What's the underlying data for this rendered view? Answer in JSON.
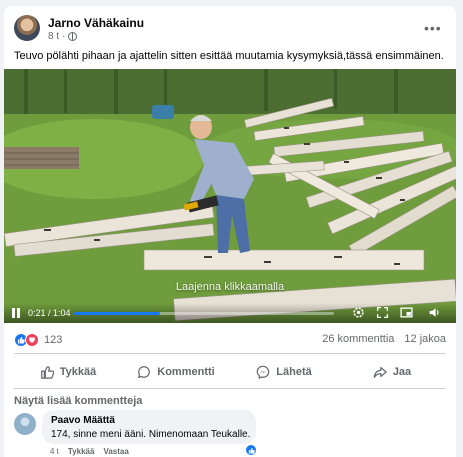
{
  "post": {
    "author": "Jarno Vähäkainu",
    "time": "8 t",
    "text": "Teuvo pölähti pihaan ja ajattelin sitten esittää muutamia kysymyksiä,tässä ensimmäinen."
  },
  "video": {
    "overlay_text": "Laajenna klikkaamalla",
    "time_display": "0:21 / 1:04",
    "progress": 0.33
  },
  "reactions": {
    "count": "123",
    "comments": "26 kommenttia",
    "shares": "12 jakoa"
  },
  "actions": {
    "like": "Tykkää",
    "comment": "Kommentti",
    "send": "Lähetä",
    "share": "Jaa"
  },
  "comments_section": {
    "more_label": "Näytä lisää kommentteja",
    "comment": {
      "author": "Paavo Määttä",
      "text": "174, sinne meni ääni. Nimenomaan Teukalle.",
      "time": "4 t",
      "like_label": "Tykkää",
      "reply_label": "Vastaa"
    }
  },
  "colors": {
    "accent": "#1877f2",
    "love": "#f33e58",
    "secondary_text": "#65676b"
  }
}
